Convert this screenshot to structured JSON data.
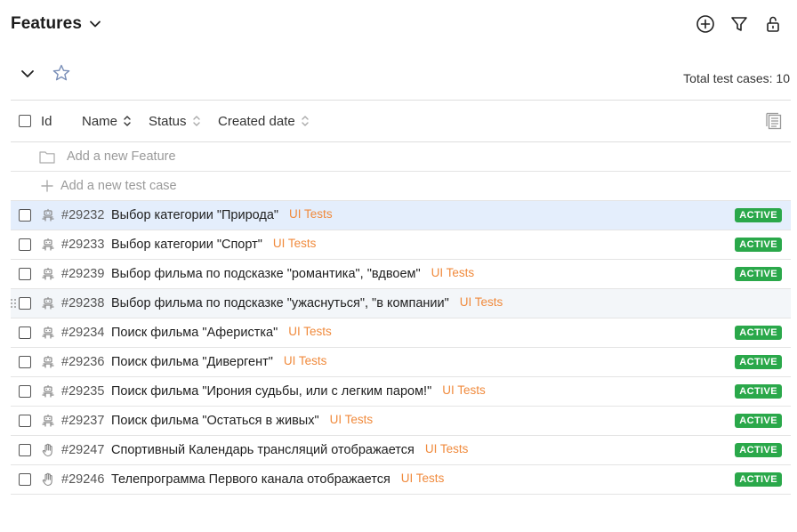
{
  "header": {
    "title": "Features"
  },
  "toolbar": {
    "total_label": "Total test cases: 10"
  },
  "table": {
    "columns": {
      "id": "Id",
      "name": "Name",
      "status": "Status",
      "created": "Created date"
    },
    "add_feature": "Add a new Feature",
    "add_case": "Add a new test case"
  },
  "rows": [
    {
      "id": "#29232",
      "name": "Выбор категории \"Природа\"",
      "tag": "UI Tests",
      "status": "ACTIVE",
      "type": "automated"
    },
    {
      "id": "#29233",
      "name": "Выбор категории \"Спорт\"",
      "tag": "UI Tests",
      "status": "ACTIVE",
      "type": "automated"
    },
    {
      "id": "#29239",
      "name": "Выбор фильма по подсказке \"романтика\", \"вдвоем\"",
      "tag": "UI Tests",
      "status": "ACTIVE",
      "type": "automated"
    },
    {
      "id": "#29238",
      "name": "Выбор фильма по подсказке \"ужаснуться\", \"в компании\"",
      "tag": "UI Tests",
      "status": "",
      "type": "automated"
    },
    {
      "id": "#29234",
      "name": "Поиск фильма \"Аферистка\"",
      "tag": "UI Tests",
      "status": "ACTIVE",
      "type": "automated"
    },
    {
      "id": "#29236",
      "name": "Поиск фильма \"Дивергент\"",
      "tag": "UI Tests",
      "status": "ACTIVE",
      "type": "automated"
    },
    {
      "id": "#29235",
      "name": "Поиск фильма \"Ирония судьбы, или с легким паром!\"",
      "tag": "UI Tests",
      "status": "ACTIVE",
      "type": "automated"
    },
    {
      "id": "#29237",
      "name": "Поиск фильма \"Остаться в живых\"",
      "tag": "UI Tests",
      "status": "ACTIVE",
      "type": "automated"
    },
    {
      "id": "#29247",
      "name": "Спортивный Календарь трансляций отображается",
      "tag": "UI Tests",
      "status": "ACTIVE",
      "type": "manual"
    },
    {
      "id": "#29246",
      "name": "Телепрограмма Первого канала отображается",
      "tag": "UI Tests",
      "status": "ACTIVE",
      "type": "manual"
    }
  ],
  "icons": {
    "add": "plus-circle-icon",
    "filter": "filter-icon",
    "lock": "lock-open-icon",
    "automated": "robot-icon",
    "manual": "hand-icon"
  },
  "colors": {
    "selected_row": "#e4eefc",
    "badge_active": "#2aa84a",
    "tag": "#f08a3c"
  }
}
